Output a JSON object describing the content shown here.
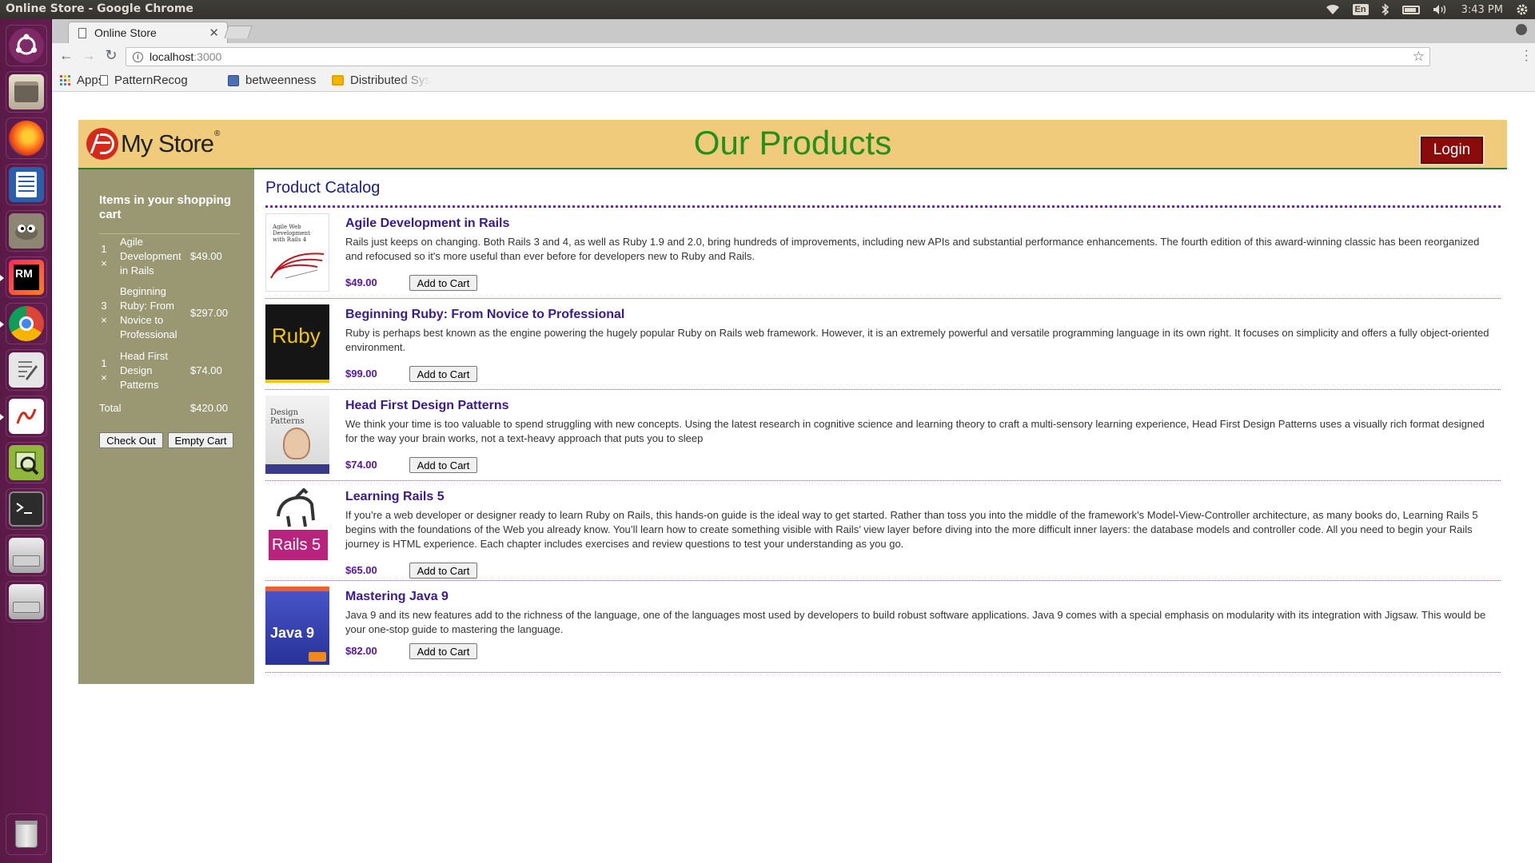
{
  "window": {
    "title": "Online Store - Google Chrome"
  },
  "system": {
    "keyboard_layout": "En",
    "time": "3:43 PM"
  },
  "launcher": {
    "apps": [
      "ubuntu-dash-icon",
      "files-icon",
      "firefox-icon",
      "writer-icon",
      "gimp-icon",
      "rubymine-icon",
      "chrome-icon",
      "text-editor-icon",
      "pdf-viewer-icon",
      "image-viewer-icon",
      "terminal-icon",
      "drive-icon",
      "drive-icon",
      "trash-icon"
    ],
    "rubymine_label": "RM"
  },
  "browser": {
    "tab_title": "Online Store",
    "url_host": "localhost",
    "url_port": ":3000",
    "bookmarks": [
      "Apps",
      "PatternRecog",
      "betweenness",
      "Distributed Sys"
    ]
  },
  "store": {
    "logo_text": "My Store",
    "logo_reg": "®",
    "heading": "Our Products",
    "login_label": "Login",
    "catalog_title": "Product Catalog",
    "cart": {
      "title": "Items in your shopping cart",
      "items": [
        {
          "qty": "1",
          "times": "×",
          "name": "Agile Development in Rails",
          "price": "$49.00"
        },
        {
          "qty": "3",
          "times": "×",
          "name": "Beginning Ruby: From Novice to Professional",
          "price": "$297.00"
        },
        {
          "qty": "1",
          "times": "×",
          "name": "Head First Design Patterns",
          "price": "$74.00"
        }
      ],
      "total_label": "Total",
      "total_value": "$420.00",
      "checkout_label": "Check Out",
      "empty_label": "Empty Cart"
    },
    "add_label": "Add to Cart",
    "products": [
      {
        "title": "Agile Development in Rails",
        "description": "Rails just keeps on changing. Both Rails 3 and 4, as well as Ruby 1.9 and 2.0, bring hundreds of improvements, including new APIs and substantial performance enhancements. The fourth edition of this award-winning classic has been reorganized and refocused so it's more useful than ever before for developers new to Ruby and Rails.",
        "price": "$49.00",
        "cover_text": "Agile Web Development with Rails 4"
      },
      {
        "title": "Beginning Ruby: From Novice to Professional",
        "description": "Ruby is perhaps best known as the engine powering the hugely popular Ruby on Rails web framework. However, it is an extremely powerful and versatile programming language in its own right. It focuses on simplicity and offers a fully object-oriented environment.",
        "price": "$99.00",
        "cover_text": "Ruby"
      },
      {
        "title": "Head First Design Patterns",
        "description": "We think your time is too valuable to spend struggling with new concepts. Using the latest research in cognitive science and learning theory to craft a multi-sensory learning experience, Head First Design Patterns uses a visually rich format designed for the way your brain works, not a text-heavy approach that puts you to sleep",
        "price": "$74.00",
        "cover_text": "Design Patterns"
      },
      {
        "title": "Learning Rails 5",
        "description": "If you’re a web developer or designer ready to learn Ruby on Rails, this hands-on guide is the ideal way to get started. Rather than toss you into the middle of the framework’s Model-View-Controller architecture, as many books do, Learning Rails 5 begins with the foundations of the Web you already know. You’ll learn how to create something visible with Rails’ view layer before diving into the more difficult inner layers: the database models and controller code. All you need to begin your Rails journey is HTML experience. Each chapter includes exercises and review questions to test your understanding as you go.",
        "price": "$65.00",
        "cover_text": "Rails 5"
      },
      {
        "title": "Mastering Java 9",
        "description": "Java 9 and its new features add to the richness of the language, one of the languages most used by developers to build robust software applications. Java 9 comes with a special emphasis on modularity with its integration with Jigsaw. This would be your one-stop guide to mastering the language.",
        "price": "$82.00",
        "cover_text": "Java 9"
      }
    ]
  }
}
